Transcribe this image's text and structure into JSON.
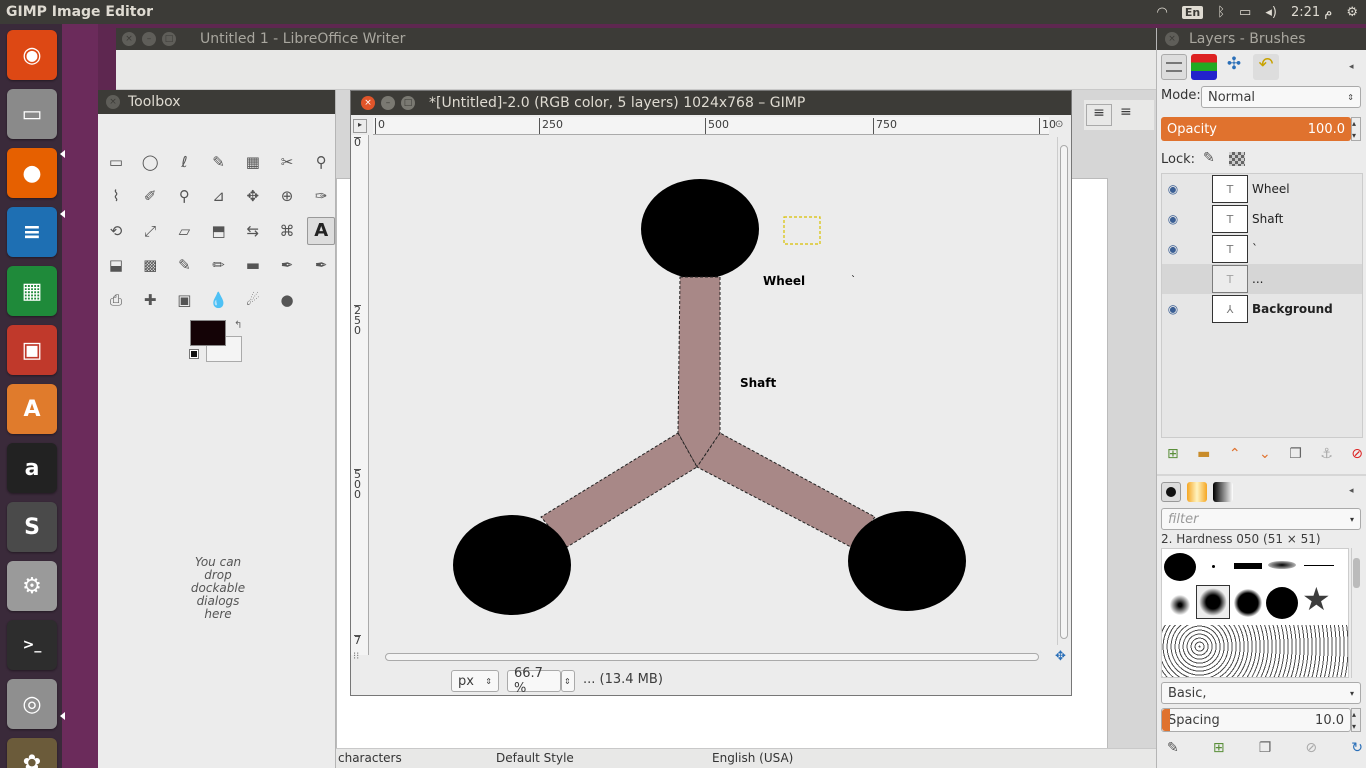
{
  "topbar": {
    "title": "GIMP Image Editor",
    "lang": "En",
    "time": "2:21 م"
  },
  "launcher": {
    "items": [
      {
        "name": "ubuntu-icon",
        "color": "#dd4814",
        "glyph": "◉"
      },
      {
        "name": "files-icon",
        "color": "#8a8a8a",
        "glyph": "▭"
      },
      {
        "name": "firefox-icon",
        "color": "#e66000",
        "glyph": "●"
      },
      {
        "name": "writer-icon",
        "color": "#1e6fb3",
        "glyph": "≡"
      },
      {
        "name": "calc-icon",
        "color": "#1f8a3a",
        "glyph": "▦"
      },
      {
        "name": "impress-icon",
        "color": "#c0392b",
        "glyph": "▣"
      },
      {
        "name": "software-center-icon",
        "color": "#e07b2c",
        "glyph": "A"
      },
      {
        "name": "amazon-icon",
        "color": "#222222",
        "glyph": "a"
      },
      {
        "name": "sublime-icon",
        "color": "#4a4a4a",
        "glyph": "S"
      },
      {
        "name": "settings-icon",
        "color": "#9a9a9a",
        "glyph": "⚙"
      },
      {
        "name": "terminal-icon",
        "color": "#2d2d2d",
        "glyph": ">_"
      },
      {
        "name": "camera-icon",
        "color": "#8f8f8f",
        "glyph": "◎"
      },
      {
        "name": "gimp-icon",
        "color": "#6b5b3a",
        "glyph": "✿"
      }
    ]
  },
  "writer": {
    "title": "Untitled 1 - LibreOffice Writer",
    "status": {
      "words": "characters",
      "style": "Default Style",
      "lang": "English (USA)"
    }
  },
  "toolbox": {
    "title": "Toolbox",
    "drop_message": "You can drop dockable dialogs here",
    "fg_color": "#140306",
    "bg_color": "#f4f4f4",
    "tools": [
      "rect-select-tool",
      "ellipse-select-tool",
      "free-select-tool",
      "fuzzy-select-tool",
      "color-select-tool",
      "scissors-select-tool",
      "foreground-select-tool",
      "paths-tool",
      "color-picker-tool",
      "zoom-tool",
      "measure-tool",
      "move-tool",
      "alignment-tool",
      "crop-tool",
      "rotate-tool",
      "scale-tool",
      "shear-tool",
      "perspective-tool",
      "flip-tool",
      "cage-transform-tool",
      "text-tool",
      "bucket-fill-tool",
      "gradient-tool",
      "pencil-tool",
      "paintbrush-tool",
      "eraser-tool",
      "airbrush-tool",
      "ink-tool",
      "clone-tool",
      "heal-tool",
      "perspective-clone-tool",
      "blur-tool",
      "smudge-tool",
      "dodge-burn-tool"
    ]
  },
  "gimp": {
    "title": "*[Untitled]-2.0 (RGB color, 5 layers) 1024x768 – GIMP",
    "ruler_h": [
      "0",
      "250",
      "500",
      "750",
      "10"
    ],
    "ruler_v": [
      "0",
      "2\n5\n0",
      "5\n0\n0",
      "7"
    ],
    "canvas_labels": {
      "wheel": "Wheel",
      "shaft": "Shaft",
      "mark": "`"
    },
    "unit": "px",
    "zoom": "66.7 %",
    "status": "... (13.4 MB)"
  },
  "dock": {
    "title": "Layers - Brushes",
    "mode_label": "Mode:",
    "mode": "Normal",
    "opacity_label": "Opacity",
    "opacity": "100.0",
    "lock_label": "Lock:",
    "layers": [
      {
        "name": "Wheel",
        "visible": true,
        "bold": false,
        "thumb": "T"
      },
      {
        "name": "Shaft",
        "visible": true,
        "bold": false,
        "thumb": "T"
      },
      {
        "name": "`",
        "visible": true,
        "bold": false,
        "thumb": "T"
      },
      {
        "name": "...",
        "visible": false,
        "bold": false,
        "thumb": "T"
      },
      {
        "name": "Background",
        "visible": true,
        "bold": true,
        "thumb": "⅄"
      }
    ],
    "filter_placeholder": "filter",
    "brush_title": "2. Hardness 050 (51 × 51)",
    "brush_preset": "Basic,",
    "spacing_label": "Spacing",
    "spacing": "10.0"
  }
}
